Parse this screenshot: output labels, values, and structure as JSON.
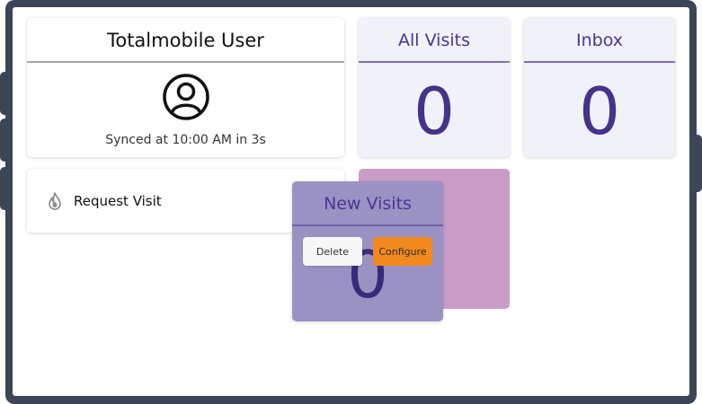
{
  "user_card": {
    "title": "Totalmobile User",
    "sync_status": "Synced at 10:00 AM in 3s",
    "icon": "user-circle-icon"
  },
  "tiles": [
    {
      "title": "All Visits",
      "count": "0"
    },
    {
      "title": "Inbox",
      "count": "0"
    }
  ],
  "request_card": {
    "label": "Request Visit",
    "icon": "flame-icon"
  },
  "dragged_tile": {
    "title": "New Visits",
    "count": "0",
    "delete_label": "Delete",
    "configure_label": "Configure"
  },
  "colors": {
    "frame": "#3a4657",
    "tile_bg": "#f1f1f9",
    "tile_text": "#4a3591",
    "drop_placeholder": "#c99dc8",
    "dragged_tile_bg": "#9b92c4",
    "configure_button": "#f28a1e"
  }
}
